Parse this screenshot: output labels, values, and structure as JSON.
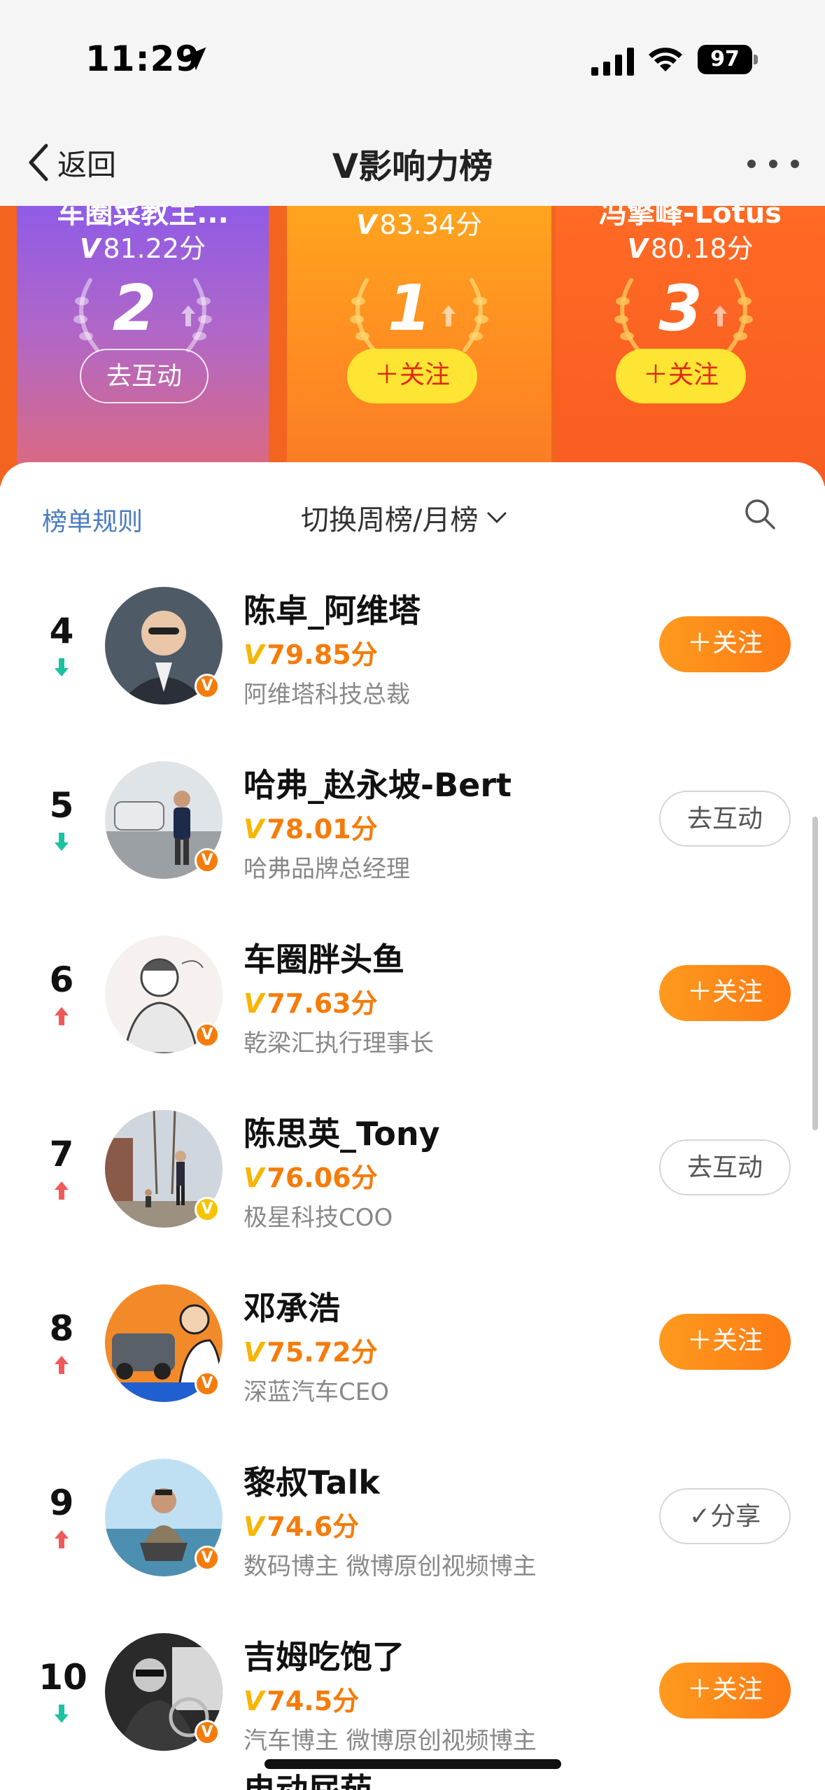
{
  "status_bar": {
    "time": "11:29",
    "battery": "97"
  },
  "nav": {
    "back_label": "返回",
    "title": "V影响力榜"
  },
  "podium": [
    {
      "rank": "2",
      "name": "车圈菜教主...",
      "score_v": "V",
      "score": "81.22分",
      "button": "去互动",
      "button_style": "ghost"
    },
    {
      "rank": "1",
      "name": "",
      "score_v": "V",
      "score": "83.34分",
      "button": "＋关注",
      "button_style": "yellow"
    },
    {
      "rank": "3",
      "name": "冯擎峰-Lotus",
      "score_v": "V",
      "score": "80.18分",
      "button": "＋关注",
      "button_style": "yellow"
    }
  ],
  "list_header": {
    "rules": "榜单规则",
    "switch": "切换周榜/月榜"
  },
  "rows": [
    {
      "rank": "4",
      "trend": "down",
      "name": "陈卓_阿维塔",
      "score_v": "V",
      "score": "79.85分",
      "desc": "阿维塔科技总裁",
      "button": "＋关注",
      "button_style": "follow",
      "badge": "orange"
    },
    {
      "rank": "5",
      "trend": "down",
      "name": "哈弗_赵永坡-Bert",
      "score_v": "V",
      "score": "78.01分",
      "desc": "哈弗品牌总经理",
      "button": "去互动",
      "button_style": "ghost",
      "badge": "orange"
    },
    {
      "rank": "6",
      "trend": "up",
      "name": "车圈胖头鱼",
      "score_v": "V",
      "score": "77.63分",
      "desc": "乾梁汇执行理事长",
      "button": "＋关注",
      "button_style": "follow",
      "badge": "orange"
    },
    {
      "rank": "7",
      "trend": "up",
      "name": "陈思英_Tony",
      "score_v": "V",
      "score": "76.06分",
      "desc": "极星科技COO",
      "button": "去互动",
      "button_style": "ghost",
      "badge": "gold"
    },
    {
      "rank": "8",
      "trend": "up",
      "name": "邓承浩",
      "score_v": "V",
      "score": "75.72分",
      "desc": "深蓝汽车CEO",
      "button": "＋关注",
      "button_style": "follow",
      "badge": "orange"
    },
    {
      "rank": "9",
      "trend": "up",
      "name": "黎叔Talk",
      "score_v": "V",
      "score": "74.6分",
      "desc": "数码博主 微博原创视频博主",
      "button": "✓分享",
      "button_style": "ghost",
      "badge": "orange"
    },
    {
      "rank": "10",
      "trend": "down",
      "name": "吉姆吃饱了",
      "score_v": "V",
      "score": "74.5分",
      "desc": "汽车博主 微博原创视频博主",
      "button": "＋关注",
      "button_style": "follow",
      "badge": "orange"
    }
  ],
  "partial_row_name": "电动屁茄",
  "colors": {
    "accent_orange": "#f57c0a",
    "link_blue": "#4a7cc0",
    "trend_up": "#f05a5a",
    "trend_down": "#19c2a0"
  }
}
